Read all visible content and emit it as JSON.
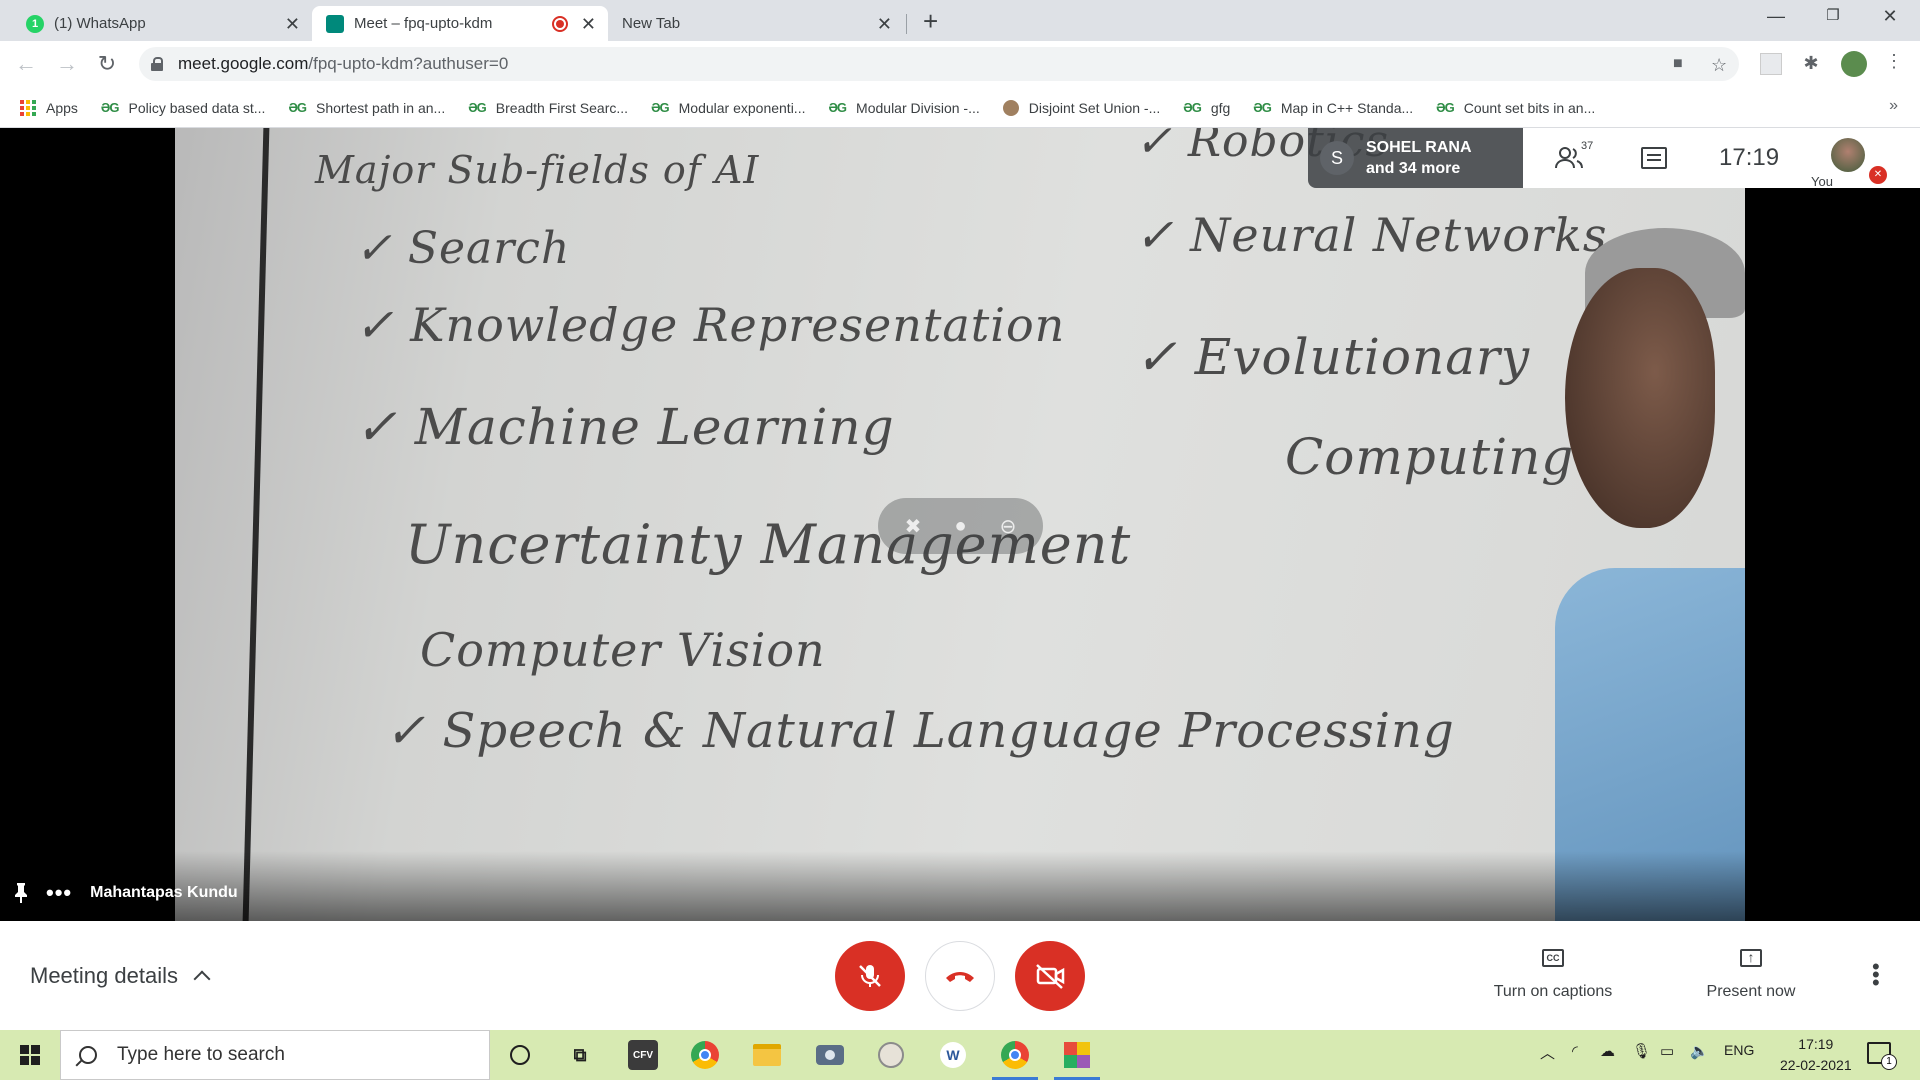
{
  "browser": {
    "tabs": [
      {
        "label": "(1) WhatsApp",
        "badge": "1",
        "active": false
      },
      {
        "label": "Meet – fpq-upto-kdm",
        "active": true
      },
      {
        "label": "New Tab",
        "active": false
      }
    ],
    "url_host": "meet.google.com",
    "url_rest": "/fpq-upto-kdm?authuser=0",
    "bookmarks": [
      {
        "label": "Apps",
        "icon": "apps-grid-icon"
      },
      {
        "label": "Policy based data st...",
        "icon": "gfg-icon"
      },
      {
        "label": "Shortest path in an...",
        "icon": "gfg-icon"
      },
      {
        "label": "Breadth First Searc...",
        "icon": "gfg-icon"
      },
      {
        "label": "Modular exponenti...",
        "icon": "gfg-icon"
      },
      {
        "label": "Modular Division -...",
        "icon": "gfg-icon"
      },
      {
        "label": "Disjoint Set Union -...",
        "icon": "site-icon"
      },
      {
        "label": "gfg",
        "icon": "gfg-icon"
      },
      {
        "label": "Map in C++ Standa...",
        "icon": "gfg-icon"
      },
      {
        "label": "Count set bits in an...",
        "icon": "gfg-icon"
      }
    ],
    "bookmark_more": "»"
  },
  "meet": {
    "presenter_initial": "S",
    "presenter_name": "SOHEL RANA",
    "presenter_more": "and 34 more",
    "participant_count": "37",
    "clock": "17:19",
    "self_label": "You",
    "speaker_name": "Mahantapas Kundu",
    "meeting_details_label": "Meeting details",
    "captions_label": "Turn on captions",
    "present_label": "Present now",
    "captions_icon_text": "CC"
  },
  "whiteboard": {
    "heading": "Major Sub-fields of AI",
    "left_items": [
      "✓ Search",
      "✓ Knowledge Representation",
      "✓ Machine Learning",
      "Uncertainty Management",
      "Computer Vision",
      "✓ Speech & Natural Language Processing"
    ],
    "right_items": [
      "✓ Robotics",
      "✓ Neural Networks",
      "✓ Evolutionary",
      "Computing"
    ]
  },
  "taskbar": {
    "search_placeholder": "Type here to search",
    "language": "ENG",
    "time": "17:19",
    "date": "22-02-2021",
    "notification_count": "1",
    "cfv_label": "CFV"
  },
  "colors": {
    "meet_red": "#d93025",
    "taskbar_bg": "#d7eab2",
    "tab_strip": "#dee1e6"
  }
}
